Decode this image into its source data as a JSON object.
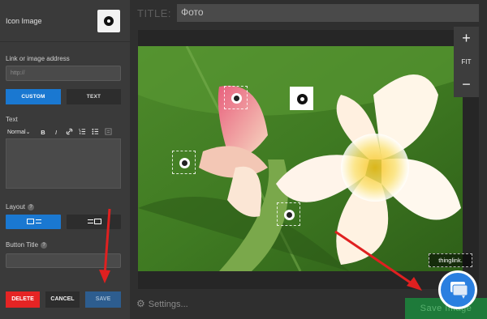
{
  "sidebar": {
    "icon_label": "Icon Image",
    "link_label": "Link or image address",
    "link_placeholder": "http://",
    "custom_label": "CUSTOM",
    "text_label": "TEXT",
    "text_section_label": "Text",
    "toolbar": {
      "style": "Normal",
      "bold": "B",
      "italic": "I"
    },
    "layout_label": "Layout",
    "button_title_label": "Button Title",
    "help_glyph": "?",
    "delete_label": "DELETE",
    "cancel_label": "CANCEL",
    "save_label": "SAVE"
  },
  "editor": {
    "title_prefix": "TITLE:",
    "title_value": "Фото",
    "zoom_in": "+",
    "zoom_fit": "FIT",
    "zoom_out": "−",
    "settings_label": "Settings...",
    "save_image_label": "Save Image",
    "watermark": "thinglink."
  },
  "colors": {
    "accent_blue": "#1a78d1",
    "delete_red": "#e52424",
    "save_green": "#1e7a3a",
    "annotation_arrow": "#e02020"
  },
  "icons": [
    "pin-icon",
    "link-icon",
    "ordered-list-icon",
    "bullet-list-icon",
    "quote-icon",
    "image-left-layout-icon",
    "image-right-layout-icon",
    "gear-icon",
    "chat-icon"
  ]
}
